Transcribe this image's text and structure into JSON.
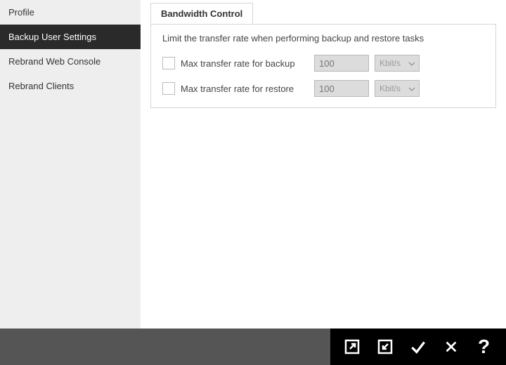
{
  "sidebar": {
    "items": [
      {
        "label": "Profile"
      },
      {
        "label": "Backup User Settings"
      },
      {
        "label": "Rebrand Web Console"
      },
      {
        "label": "Rebrand Clients"
      }
    ],
    "activeIndex": 1
  },
  "tabs": {
    "active": {
      "label": "Bandwidth Control"
    }
  },
  "panel": {
    "description": "Limit the transfer rate when performing backup and restore tasks",
    "backup": {
      "label": "Max transfer rate for backup",
      "value": "100",
      "unit": "Kbit/s",
      "checked": false
    },
    "restore": {
      "label": "Max transfer rate for restore",
      "value": "100",
      "unit": "Kbit/s",
      "checked": false
    }
  },
  "footer": {
    "export": "Export",
    "import": "Import",
    "ok": "OK",
    "cancel": "Cancel",
    "help": "Help"
  }
}
